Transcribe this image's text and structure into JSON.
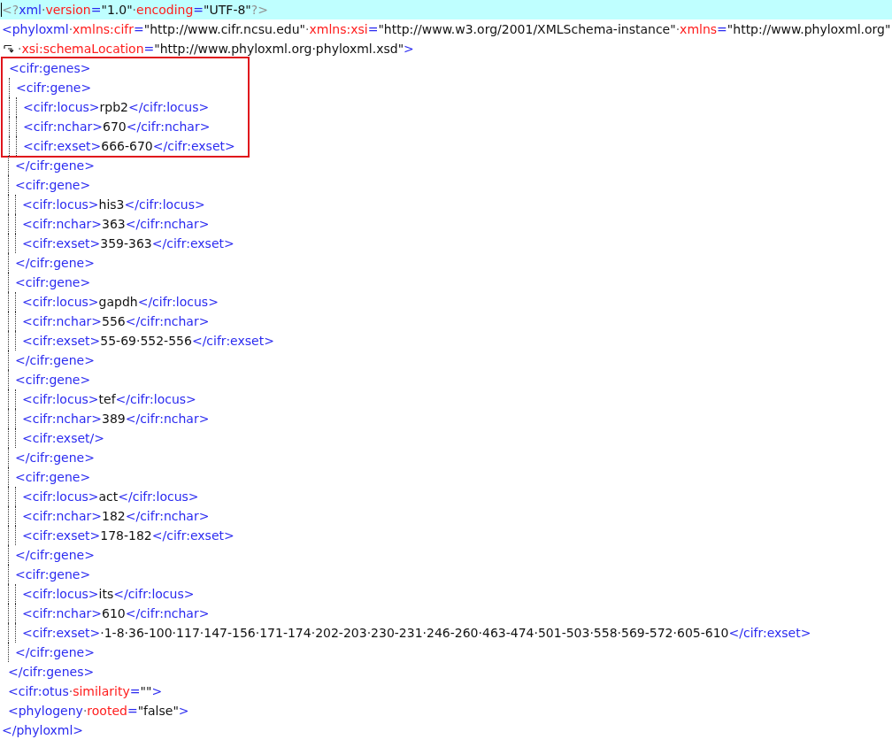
{
  "document": [
    {
      "line": [
        {
          "kind": "grey",
          "text": "<?"
        },
        {
          "kind": "tag",
          "text": "xml"
        },
        {
          "kind": "dot",
          "text": "·"
        },
        {
          "kind": "attr",
          "text": "version"
        },
        {
          "kind": "tag",
          "text": "="
        },
        {
          "kind": "value",
          "text": "\"1.0\""
        },
        {
          "kind": "dot",
          "text": "·"
        },
        {
          "kind": "attr",
          "text": "encoding"
        },
        {
          "kind": "tag",
          "text": "="
        },
        {
          "kind": "value",
          "text": "\"UTF-8\""
        },
        {
          "kind": "grey",
          "text": "?>"
        }
      ],
      "current": true,
      "boxed": false
    },
    {
      "line": [
        {
          "kind": "tag",
          "text": "<phyloxml"
        },
        {
          "kind": "dot",
          "text": "·"
        },
        {
          "kind": "attr",
          "text": "xmlns:cifr"
        },
        {
          "kind": "tag",
          "text": "="
        },
        {
          "kind": "value",
          "text": "\"http://www.cifr.ncsu.edu\""
        },
        {
          "kind": "dot",
          "text": "·"
        },
        {
          "kind": "attr",
          "text": "xmlns:xsi"
        },
        {
          "kind": "tag",
          "text": "="
        },
        {
          "kind": "value",
          "text": "\"http://www.w3.org/2001/XMLSchema-instance\""
        },
        {
          "kind": "dot",
          "text": "·"
        },
        {
          "kind": "attr",
          "text": "xmlns"
        },
        {
          "kind": "tag",
          "text": "="
        },
        {
          "kind": "value",
          "text": "\"http://www.phyloxml.org\""
        }
      ],
      "wrapped": [
        {
          "kind": "dot",
          "text": "·"
        },
        {
          "kind": "attr",
          "text": "xsi:schemaLocation"
        },
        {
          "kind": "tag",
          "text": "="
        },
        {
          "kind": "value",
          "text": "\"http://www.phyloxml.org·phyloxml.xsd\""
        },
        {
          "kind": "tag",
          "text": ">"
        }
      ],
      "current": false,
      "boxed": false,
      "children": [
        {
          "line": [
            {
              "kind": "tag",
              "text": "<cifr:genes>"
            }
          ],
          "current": false,
          "boxed": true,
          "children": [
            {
              "line": [
                {
                  "kind": "tag",
                  "text": "<cifr:gene>"
                }
              ],
              "current": false,
              "boxed": true,
              "children": [
                {
                  "line": [
                    {
                      "kind": "tag",
                      "text": "<cifr:locus>"
                    },
                    {
                      "kind": "text",
                      "text": "rpb2"
                    },
                    {
                      "kind": "tag",
                      "text": "</cifr:locus>"
                    }
                  ],
                  "current": false,
                  "boxed": true
                },
                {
                  "line": [
                    {
                      "kind": "tag",
                      "text": "<cifr:nchar>"
                    },
                    {
                      "kind": "text",
                      "text": "670"
                    },
                    {
                      "kind": "tag",
                      "text": "</cifr:nchar>"
                    }
                  ],
                  "current": false,
                  "boxed": true
                },
                {
                  "line": [
                    {
                      "kind": "tag",
                      "text": "<cifr:exset>"
                    },
                    {
                      "kind": "text",
                      "text": "666-670"
                    },
                    {
                      "kind": "tag",
                      "text": "</cifr:exset>"
                    }
                  ],
                  "current": false,
                  "boxed": true
                }
              ],
              "close": {
                "line": [
                  {
                    "kind": "tag",
                    "text": "</cifr:gene>"
                  }
                ],
                "current": false,
                "boxed": false
              }
            },
            {
              "line": [
                {
                  "kind": "tag",
                  "text": "<cifr:gene>"
                }
              ],
              "current": false,
              "boxed": false,
              "children": [
                {
                  "line": [
                    {
                      "kind": "tag",
                      "text": "<cifr:locus>"
                    },
                    {
                      "kind": "text",
                      "text": "his3"
                    },
                    {
                      "kind": "tag",
                      "text": "</cifr:locus>"
                    }
                  ],
                  "current": false,
                  "boxed": false
                },
                {
                  "line": [
                    {
                      "kind": "tag",
                      "text": "<cifr:nchar>"
                    },
                    {
                      "kind": "text",
                      "text": "363"
                    },
                    {
                      "kind": "tag",
                      "text": "</cifr:nchar>"
                    }
                  ],
                  "current": false,
                  "boxed": false
                },
                {
                  "line": [
                    {
                      "kind": "tag",
                      "text": "<cifr:exset>"
                    },
                    {
                      "kind": "text",
                      "text": "359-363"
                    },
                    {
                      "kind": "tag",
                      "text": "</cifr:exset>"
                    }
                  ],
                  "current": false,
                  "boxed": false
                }
              ],
              "close": {
                "line": [
                  {
                    "kind": "tag",
                    "text": "</cifr:gene>"
                  }
                ],
                "current": false,
                "boxed": false
              }
            },
            {
              "line": [
                {
                  "kind": "tag",
                  "text": "<cifr:gene>"
                }
              ],
              "current": false,
              "boxed": false,
              "children": [
                {
                  "line": [
                    {
                      "kind": "tag",
                      "text": "<cifr:locus>"
                    },
                    {
                      "kind": "text",
                      "text": "gapdh"
                    },
                    {
                      "kind": "tag",
                      "text": "</cifr:locus>"
                    }
                  ],
                  "current": false,
                  "boxed": false
                },
                {
                  "line": [
                    {
                      "kind": "tag",
                      "text": "<cifr:nchar>"
                    },
                    {
                      "kind": "text",
                      "text": "556"
                    },
                    {
                      "kind": "tag",
                      "text": "</cifr:nchar>"
                    }
                  ],
                  "current": false,
                  "boxed": false
                },
                {
                  "line": [
                    {
                      "kind": "tag",
                      "text": "<cifr:exset>"
                    },
                    {
                      "kind": "text",
                      "text": "55-69·552-556"
                    },
                    {
                      "kind": "tag",
                      "text": "</cifr:exset>"
                    }
                  ],
                  "current": false,
                  "boxed": false
                }
              ],
              "close": {
                "line": [
                  {
                    "kind": "tag",
                    "text": "</cifr:gene>"
                  }
                ],
                "current": false,
                "boxed": false
              }
            },
            {
              "line": [
                {
                  "kind": "tag",
                  "text": "<cifr:gene>"
                }
              ],
              "current": false,
              "boxed": false,
              "children": [
                {
                  "line": [
                    {
                      "kind": "tag",
                      "text": "<cifr:locus>"
                    },
                    {
                      "kind": "text",
                      "text": "tef"
                    },
                    {
                      "kind": "tag",
                      "text": "</cifr:locus>"
                    }
                  ],
                  "current": false,
                  "boxed": false
                },
                {
                  "line": [
                    {
                      "kind": "tag",
                      "text": "<cifr:nchar>"
                    },
                    {
                      "kind": "text",
                      "text": "389"
                    },
                    {
                      "kind": "tag",
                      "text": "</cifr:nchar>"
                    }
                  ],
                  "current": false,
                  "boxed": false
                },
                {
                  "line": [
                    {
                      "kind": "tag",
                      "text": "<cifr:exset/>"
                    }
                  ],
                  "current": false,
                  "boxed": false
                }
              ],
              "close": {
                "line": [
                  {
                    "kind": "tag",
                    "text": "</cifr:gene>"
                  }
                ],
                "current": false,
                "boxed": false
              }
            },
            {
              "line": [
                {
                  "kind": "tag",
                  "text": "<cifr:gene>"
                }
              ],
              "current": false,
              "boxed": false,
              "children": [
                {
                  "line": [
                    {
                      "kind": "tag",
                      "text": "<cifr:locus>"
                    },
                    {
                      "kind": "text",
                      "text": "act"
                    },
                    {
                      "kind": "tag",
                      "text": "</cifr:locus>"
                    }
                  ],
                  "current": false,
                  "boxed": false
                },
                {
                  "line": [
                    {
                      "kind": "tag",
                      "text": "<cifr:nchar>"
                    },
                    {
                      "kind": "text",
                      "text": "182"
                    },
                    {
                      "kind": "tag",
                      "text": "</cifr:nchar>"
                    }
                  ],
                  "current": false,
                  "boxed": false
                },
                {
                  "line": [
                    {
                      "kind": "tag",
                      "text": "<cifr:exset>"
                    },
                    {
                      "kind": "text",
                      "text": "178-182"
                    },
                    {
                      "kind": "tag",
                      "text": "</cifr:exset>"
                    }
                  ],
                  "current": false,
                  "boxed": false
                }
              ],
              "close": {
                "line": [
                  {
                    "kind": "tag",
                    "text": "</cifr:gene>"
                  }
                ],
                "current": false,
                "boxed": false
              }
            },
            {
              "line": [
                {
                  "kind": "tag",
                  "text": "<cifr:gene>"
                }
              ],
              "current": false,
              "boxed": false,
              "children": [
                {
                  "line": [
                    {
                      "kind": "tag",
                      "text": "<cifr:locus>"
                    },
                    {
                      "kind": "text",
                      "text": "its"
                    },
                    {
                      "kind": "tag",
                      "text": "</cifr:locus>"
                    }
                  ],
                  "current": false,
                  "boxed": false
                },
                {
                  "line": [
                    {
                      "kind": "tag",
                      "text": "<cifr:nchar>"
                    },
                    {
                      "kind": "text",
                      "text": "610"
                    },
                    {
                      "kind": "tag",
                      "text": "</cifr:nchar>"
                    }
                  ],
                  "current": false,
                  "boxed": false
                },
                {
                  "line": [
                    {
                      "kind": "tag",
                      "text": "<cifr:exset>"
                    },
                    {
                      "kind": "text",
                      "text": "·1-8·36-100·117·147-156·171-174·202-203·230-231·246-260·463-474·501-503·558·569-572·605-610"
                    },
                    {
                      "kind": "tag",
                      "text": "</cifr:exset>"
                    }
                  ],
                  "current": false,
                  "boxed": false
                }
              ],
              "close": {
                "line": [
                  {
                    "kind": "tag",
                    "text": "</cifr:gene>"
                  }
                ],
                "current": false,
                "boxed": false
              }
            }
          ],
          "close": {
            "line": [
              {
                "kind": "tag",
                "text": "</cifr:genes>"
              }
            ],
            "current": false,
            "boxed": false
          }
        },
        {
          "line": [
            {
              "kind": "tag",
              "text": "<cifr:otus"
            },
            {
              "kind": "dot",
              "text": "·"
            },
            {
              "kind": "attr",
              "text": "similarity"
            },
            {
              "kind": "tag",
              "text": "="
            },
            {
              "kind": "value",
              "text": "\"\""
            },
            {
              "kind": "tag",
              "text": ">"
            }
          ],
          "current": false,
          "boxed": false
        },
        {
          "line": [
            {
              "kind": "tag",
              "text": "<phylogeny"
            },
            {
              "kind": "dot",
              "text": "·"
            },
            {
              "kind": "attr",
              "text": "rooted"
            },
            {
              "kind": "tag",
              "text": "="
            },
            {
              "kind": "value",
              "text": "\"false\""
            },
            {
              "kind": "tag",
              "text": ">"
            }
          ],
          "current": false,
          "boxed": false
        }
      ],
      "close": {
        "line": [
          {
            "kind": "tag",
            "text": "</phyloxml>"
          }
        ],
        "current": false,
        "boxed": false
      }
    }
  ]
}
